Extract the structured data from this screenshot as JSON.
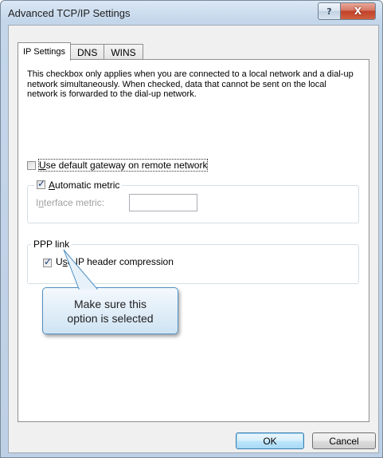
{
  "window": {
    "title": "Advanced TCP/IP Settings",
    "help_symbol": "?",
    "close_symbol": "X"
  },
  "tabs": [
    {
      "label": "IP Settings",
      "active": true
    },
    {
      "label": "DNS",
      "active": false
    },
    {
      "label": "WINS",
      "active": false
    }
  ],
  "ip_settings": {
    "description": "This checkbox only applies when you are connected to a local network and a dial-up network simultaneously.  When checked, data that cannot be sent on the local network is forwarded to the dial-up network.",
    "default_gateway": {
      "mnemonic": "U",
      "label_rest": "se default gateway on remote network",
      "checked": false
    },
    "automatic_metric": {
      "mnemonic": "A",
      "label_rest": "utomatic metric",
      "checked": true
    },
    "interface_metric": {
      "label_pre": "I",
      "mnemonic": "n",
      "label_rest": "terface metric:",
      "value": ""
    },
    "ppp_link": {
      "legend": "PPP link",
      "ip_header_compression": {
        "label_pre": "U",
        "mnemonic": "s",
        "label_rest": "e IP header compression",
        "checked": true
      }
    }
  },
  "callout": {
    "line1": "Make sure this",
    "line2": "option is selected"
  },
  "buttons": {
    "ok": "OK",
    "cancel": "Cancel"
  },
  "colors": {
    "callout_border": "#4f8fc2",
    "close_button": "#c2412a",
    "default_button_border": "#3c7fb1"
  }
}
